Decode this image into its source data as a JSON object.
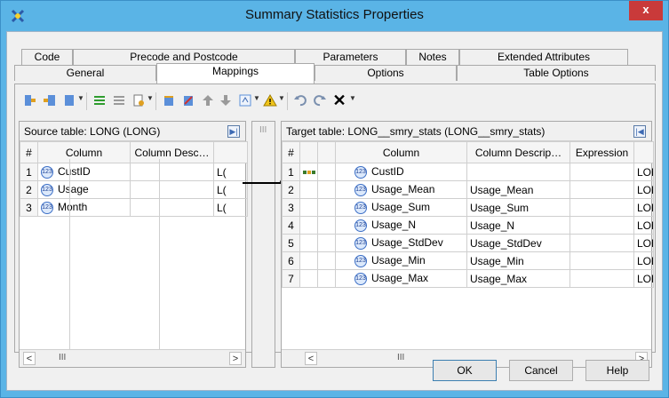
{
  "window": {
    "title": "Summary Statistics Properties",
    "close_label": "x"
  },
  "tabs": {
    "row1": [
      "Code",
      "Precode and Postcode",
      "Parameters",
      "Notes",
      "Extended Attributes"
    ],
    "row2": [
      "General",
      "Mappings",
      "Options",
      "Table Options"
    ],
    "active": "Mappings"
  },
  "toolbar": {
    "icons": [
      "map-source-icon",
      "import-icon",
      "columns-icon",
      "map-all-icon",
      "unmap-icon",
      "properties-icon",
      "new-column-icon",
      "delete-column-icon",
      "move-up-icon",
      "move-down-icon",
      "sort-icon",
      "warning-icon",
      "undo-icon",
      "redo-icon",
      "delete-icon"
    ]
  },
  "source": {
    "title": "Source table: LONG (LONG)",
    "headers": [
      "#",
      "Column",
      "Column Desc…",
      ""
    ],
    "rows": [
      {
        "num": "1",
        "column": "CustID",
        "desc": "",
        "type": "L("
      },
      {
        "num": "2",
        "column": "Usage",
        "desc": "",
        "type": "L("
      },
      {
        "num": "3",
        "column": "Month",
        "desc": "",
        "type": "L("
      }
    ]
  },
  "target": {
    "title": "Target table: LONG__smry_stats (LONG__smry_stats)",
    "headers": [
      "#",
      "",
      "",
      "Column",
      "Column Descrip…",
      "Expression",
      ""
    ],
    "rows": [
      {
        "num": "1",
        "column": "CustID",
        "desc": "",
        "expr": "",
        "type": "LON"
      },
      {
        "num": "2",
        "column": "Usage_Mean",
        "desc": "Usage_Mean",
        "expr": "",
        "type": "LON"
      },
      {
        "num": "3",
        "column": "Usage_Sum",
        "desc": "Usage_Sum",
        "expr": "",
        "type": "LON"
      },
      {
        "num": "4",
        "column": "Usage_N",
        "desc": "Usage_N",
        "expr": "",
        "type": "LON"
      },
      {
        "num": "5",
        "column": "Usage_StdDev",
        "desc": "Usage_StdDev",
        "expr": "",
        "type": "LON"
      },
      {
        "num": "6",
        "column": "Usage_Min",
        "desc": "Usage_Min",
        "expr": "",
        "type": "LON"
      },
      {
        "num": "7",
        "column": "Usage_Max",
        "desc": "Usage_Max",
        "expr": "",
        "type": "LON"
      }
    ]
  },
  "buttons": {
    "ok": "OK",
    "cancel": "Cancel",
    "help": "Help"
  }
}
